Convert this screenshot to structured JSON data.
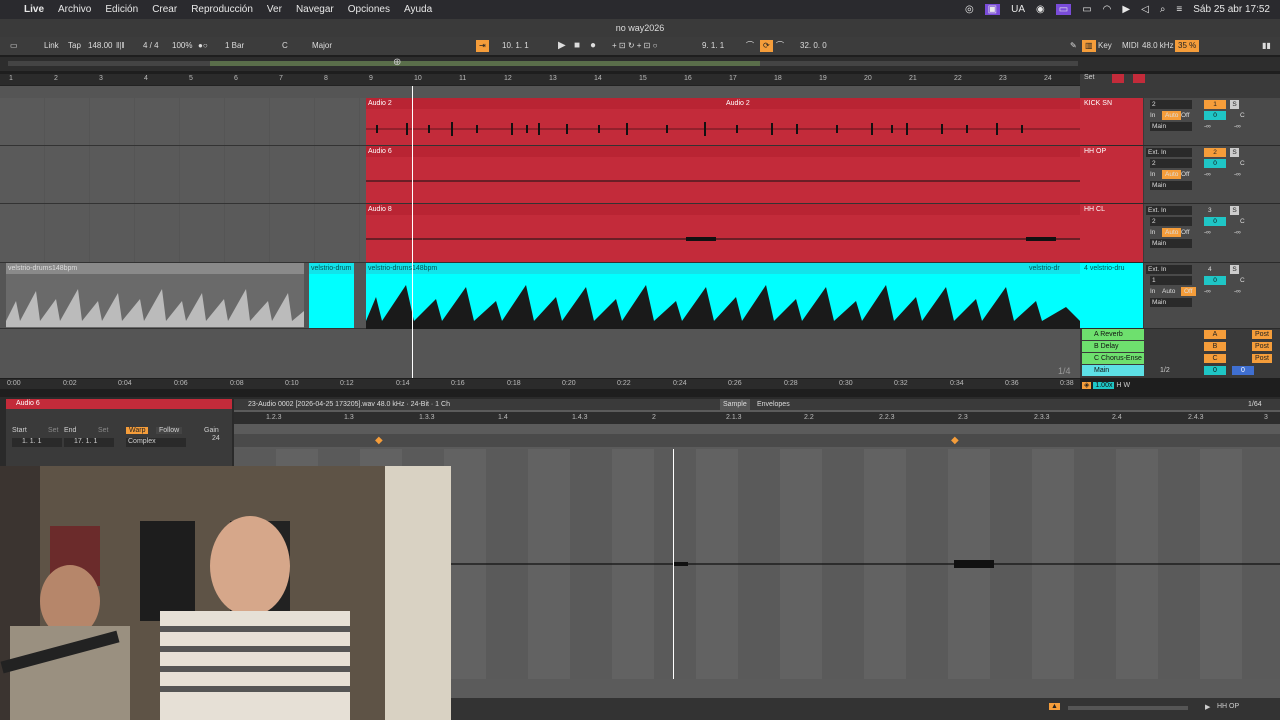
{
  "menubar": {
    "app": "Live",
    "items": [
      "Archivo",
      "Edición",
      "Crear",
      "Reproducción",
      "Ver",
      "Navegar",
      "Opciones",
      "Ayuda"
    ],
    "right": {
      "lang": "UA",
      "datetime": "Sáb 25 abr  17:52"
    }
  },
  "window": {
    "title": "no way2026"
  },
  "control": {
    "link": "Link",
    "tap": "Tap",
    "tempo": "148.00",
    "signature": "4 / 4",
    "zoom": "100%",
    "quantize": "1 Bar",
    "key": "C",
    "scale": "Major",
    "position": "10.  1.  1",
    "loop_start": "9.  1.  1",
    "loop_len": "32.  0.  0",
    "key_btn": "Key",
    "midi_btn": "MIDI",
    "sample_rate": "48.0 kHz",
    "cpu": "35 %"
  },
  "ruler": {
    "bars": [
      "1",
      "2",
      "3",
      "4",
      "5",
      "6",
      "7",
      "8",
      "9",
      "10",
      "11",
      "12",
      "13",
      "14",
      "15",
      "16",
      "17",
      "18",
      "19",
      "20",
      "21",
      "22",
      "23",
      "24"
    ],
    "set_btn": "Set"
  },
  "tracks": [
    {
      "clip_name": "Audio 2",
      "clip_name2": "Audio 2",
      "name": "KICK SN",
      "input": "2",
      "num": "1",
      "monitor": [
        "In",
        "Auto",
        "Off"
      ],
      "output": "Main",
      "vol": "0",
      "pan": "C",
      "send": "-∞"
    },
    {
      "clip_name": "Audio 6",
      "name": "HH OP",
      "input": "Ext. In",
      "input2": "2",
      "num": "2",
      "monitor": [
        "In",
        "Auto",
        "Off"
      ],
      "output": "Main",
      "vol": "0",
      "pan": "C",
      "send": "-∞"
    },
    {
      "clip_name": "Audio 8",
      "name": "HH CL",
      "input": "Ext. In",
      "input2": "2",
      "num": "3",
      "monitor": [
        "In",
        "Auto",
        "Off"
      ],
      "output": "Main",
      "vol": "0",
      "pan": "C",
      "send": "-∞"
    },
    {
      "clip_name": "velstrio-drums148bpm",
      "clip_name2": "velstrio-drum",
      "clip_name3": "velstrio-drums148bpm",
      "clip_name4": "velstrio-dr",
      "name": "4 velstrio-dru",
      "input": "Ext. In",
      "input2": "1",
      "num": "4",
      "monitor": [
        "In",
        "Auto",
        "Off"
      ],
      "output": "Main",
      "vol": "0",
      "pan": "C",
      "send": "-∞"
    }
  ],
  "returns": [
    {
      "name": "A Reverb",
      "letter": "A",
      "post": "Post"
    },
    {
      "name": "B Delay",
      "letter": "B",
      "post": "Post"
    },
    {
      "name": "C Chorus-Ense",
      "letter": "C",
      "post": "Post"
    }
  ],
  "master": {
    "name": "Main",
    "fraction": "1/2",
    "vol": "0",
    "pan": "0",
    "page": "1/4",
    "zoom": "1.00x"
  },
  "timebar": [
    "0:00",
    "0:02",
    "0:04",
    "0:06",
    "0:08",
    "0:10",
    "0:12",
    "0:14",
    "0:16",
    "0:18",
    "0:20",
    "0:22",
    "0:24",
    "0:26",
    "0:28",
    "0:30",
    "0:32",
    "0:34",
    "0:36",
    "0:38"
  ],
  "clipview": {
    "title": "Audio 6",
    "start_label": "Start",
    "end_label": "End",
    "set": "Set",
    "start": "1.  1.  1",
    "end": "17.  1.  1",
    "warp": "Warp",
    "follow": "Follow",
    "mode": "Complex",
    "gain_label": "Gain",
    "gain": "24"
  },
  "sampleview": {
    "file": "23-Audio 0002 [2026-04-25 173205].wav  48.0 kHz · 24-Bit · 1 Ch",
    "tab_sample": "Sample",
    "tab_env": "Envelopes",
    "grid": "1/64",
    "ruler": [
      "1.2.3",
      "1.3",
      "1.3.3",
      "1.4",
      "1.4.3",
      "2",
      "2.1.3",
      "2.2",
      "2.2.3",
      "2.3",
      "2.3.3",
      "2.4",
      "2.4.3",
      "3"
    ]
  },
  "bottom": {
    "track": "HH OP"
  }
}
